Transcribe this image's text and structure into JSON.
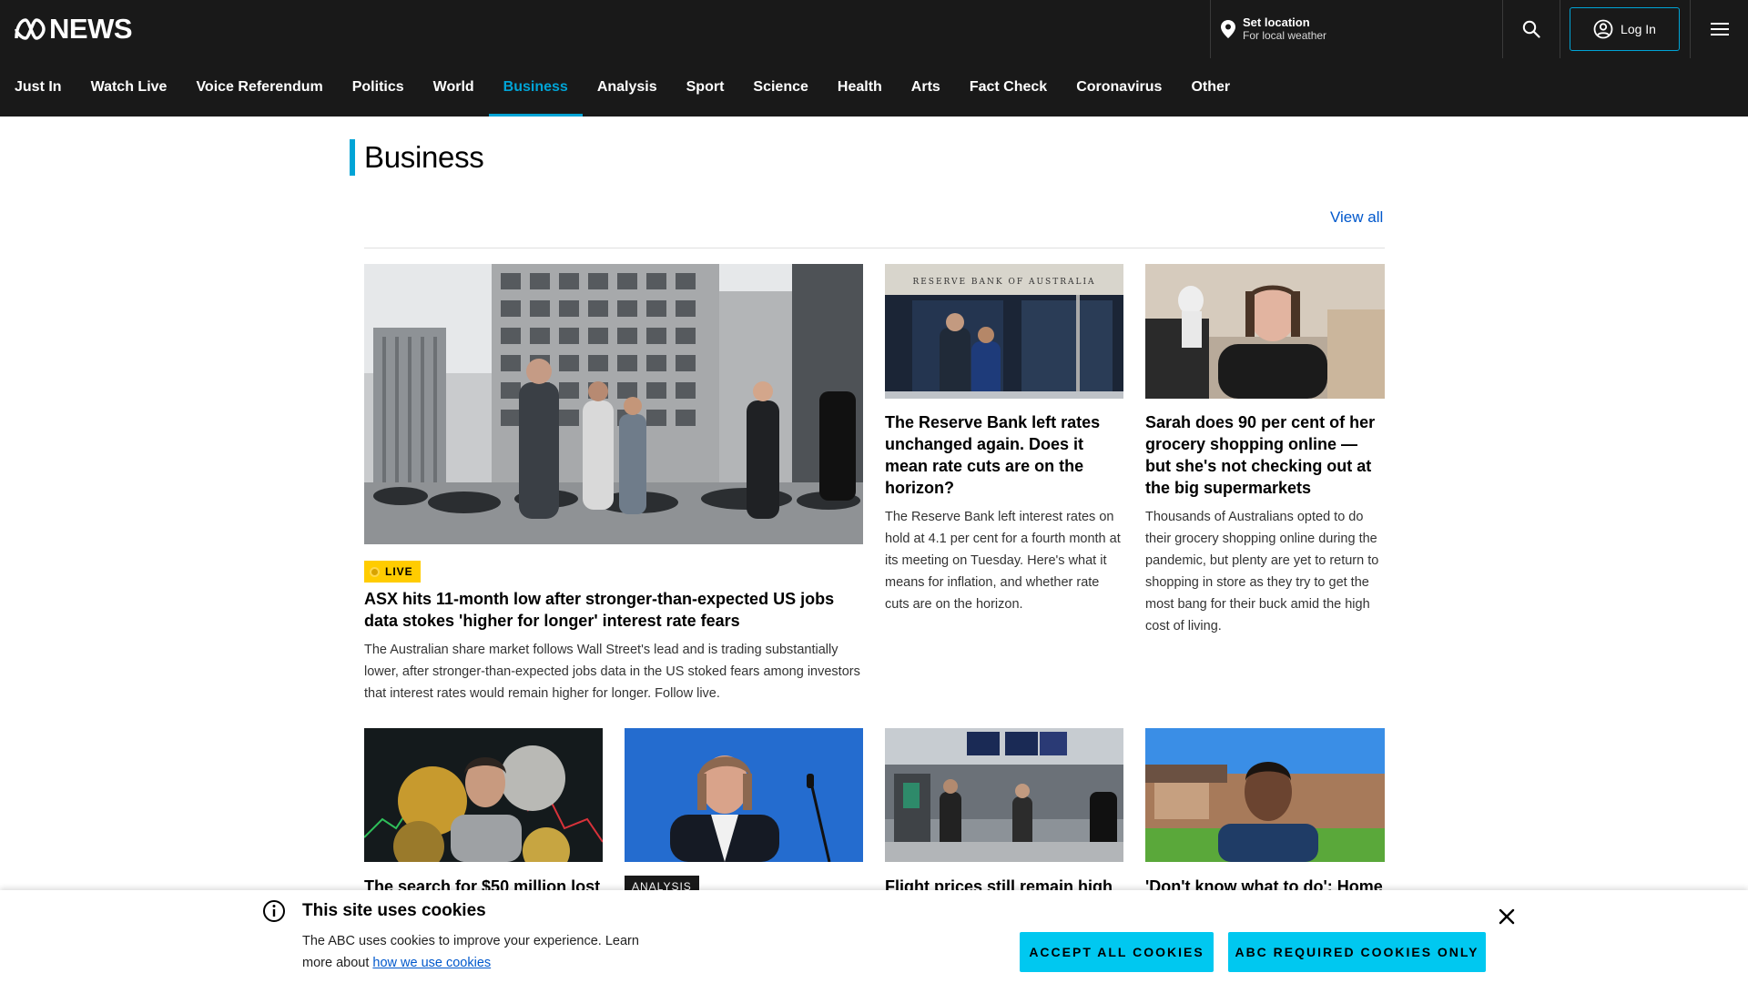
{
  "header": {
    "logo_text": "NEWS",
    "location_title": "Set location",
    "location_subtitle": "For local weather",
    "login_label": "Log In"
  },
  "nav": {
    "items": [
      {
        "label": "Just In"
      },
      {
        "label": "Watch Live"
      },
      {
        "label": "Voice Referendum"
      },
      {
        "label": "Politics"
      },
      {
        "label": "World"
      },
      {
        "label": "Business",
        "active": true
      },
      {
        "label": "Analysis"
      },
      {
        "label": "Sport"
      },
      {
        "label": "Science"
      },
      {
        "label": "Health"
      },
      {
        "label": "Arts"
      },
      {
        "label": "Fact Check"
      },
      {
        "label": "Coronavirus"
      },
      {
        "label": "Other"
      }
    ]
  },
  "section": {
    "title": "Business",
    "view_all": "View all"
  },
  "stories": [
    {
      "badge": "LIVE",
      "title": "ASX hits 11-month low after stronger-than-expected US jobs data stokes 'higher for longer' interest rate fears",
      "description": "The Australian share market follows Wall Street's lead and is trading substantially lower, after stronger-than-expected jobs data in the US stoked fears among investors that interest rates would remain higher for longer. Follow live."
    },
    {
      "title": "The Reserve Bank left rates unchanged again. Does it mean rate cuts are on the horizon?",
      "description": "The Reserve Bank left interest rates on hold at 4.1 per cent for a fourth month at its meeting on Tuesday. Here's what it means for inflation, and whether rate cuts are on the horizon.",
      "image_text": "RESERVE BANK OF AUSTRALIA"
    },
    {
      "title": "Sarah does 90 per cent of her grocery shopping online — but she's not checking out at the big supermarkets",
      "description": "Thousands of Australians opted to do their grocery shopping online during the pandemic, but plenty are yet to return to shopping in store as they try to get the most bang for their buck amid the high cost of living."
    },
    {
      "title": "The search for $50 million lost"
    },
    {
      "badge": "ANALYSIS",
      "title": ""
    },
    {
      "title": "Flight prices still remain high"
    },
    {
      "title": "'Don't know what to do': Home"
    }
  ],
  "cookie": {
    "title": "This site uses cookies",
    "text": "The ABC uses cookies to improve your experience. Learn more about ",
    "link": "how we use cookies",
    "accept_all": "ACCEPT ALL COOKIES",
    "required_only": "ABC REQUIRED COOKIES ONLY"
  },
  "colors": {
    "header_bg": "#191919",
    "accent": "#00a4d6",
    "live_badge": "#ffcc00",
    "link": "#0058cc",
    "cookie_button": "#00c8f0"
  },
  "icons": {
    "location": "location-pin-icon",
    "search": "search-icon",
    "user": "user-circle-icon",
    "menu": "hamburger-menu-icon",
    "info": "info-icon",
    "close": "close-icon"
  }
}
